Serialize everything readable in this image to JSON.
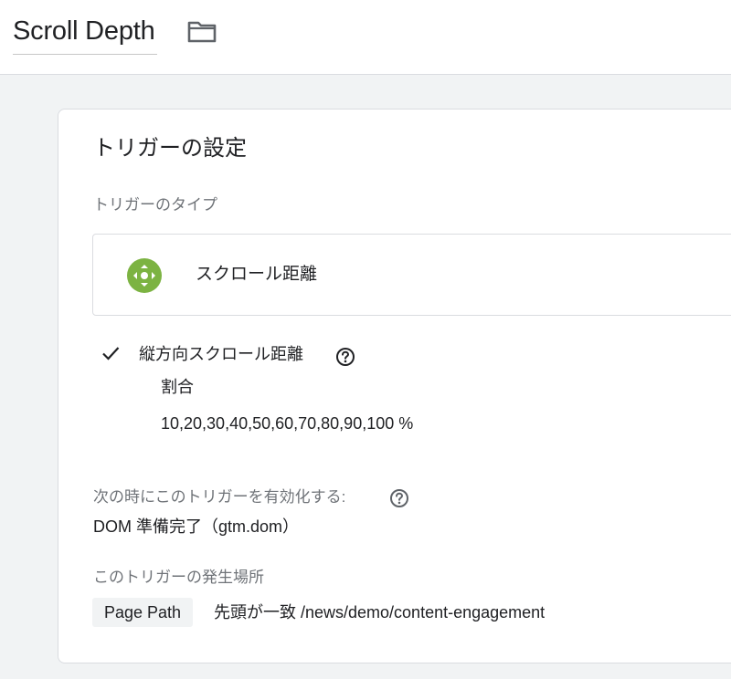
{
  "header": {
    "title": "Scroll Depth",
    "folder_icon": "folder-icon"
  },
  "trigger_config": {
    "heading": "トリガーの設定",
    "type_label": "トリガーのタイプ",
    "type": {
      "icon": "scroll-move-icon",
      "icon_color": "#7cb342",
      "name": "スクロール距離"
    },
    "vertical_scroll": {
      "checked": true,
      "label": "縦方向スクロール距離",
      "unit_label": "割合",
      "values": "10,20,30,40,50,60,70,80,90,100 %"
    },
    "enable_when": {
      "label": "次の時にこのトリガーを有効化する:",
      "value": "DOM 準備完了（gtm.dom）"
    },
    "fires_on": {
      "label": "このトリガーの発生場所",
      "variable": "Page Path",
      "condition": "先頭が一致 /news/demo/content-engagement"
    }
  }
}
